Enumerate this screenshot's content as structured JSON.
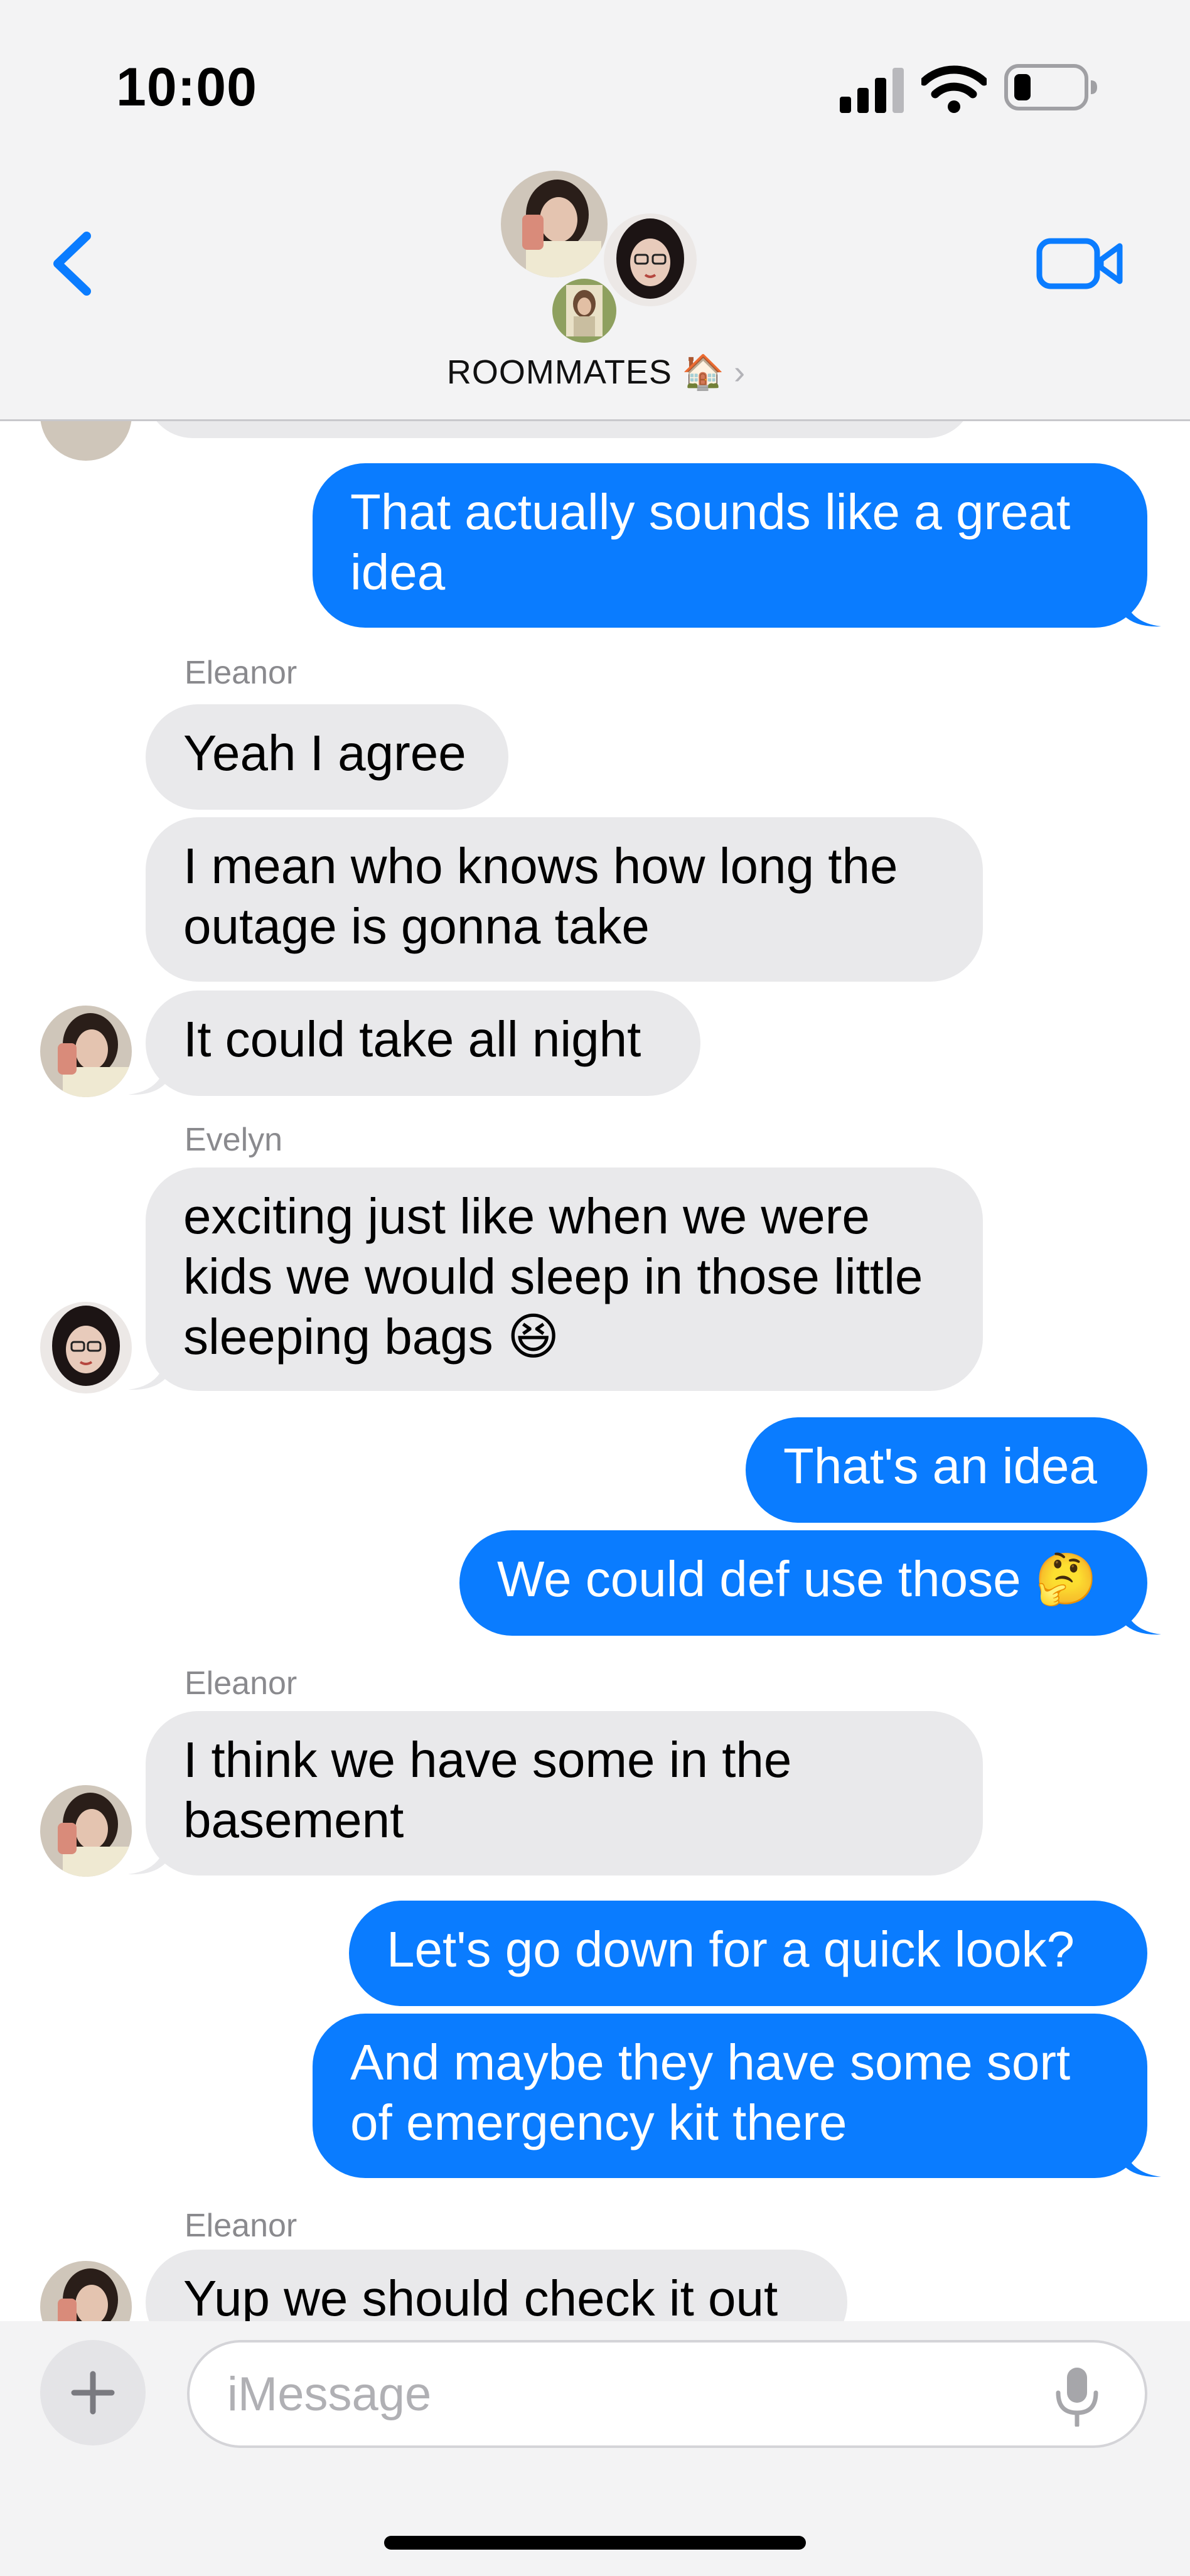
{
  "status_bar": {
    "time": "10:00"
  },
  "header": {
    "group_name": "ROOMMATES",
    "group_emoji": "🏠",
    "chevron": "›"
  },
  "messages": [
    {
      "text": "That actually sounds like a great idea"
    },
    {
      "sender": "Eleanor",
      "text": "Yeah I agree"
    },
    {
      "text": "I mean who knows how long the outage is gonna take"
    },
    {
      "text": "It could take all night"
    },
    {
      "sender": "Evelyn",
      "text": "exciting just like when we were kids we would sleep in those little sleeping bags 😆"
    },
    {
      "text": "That's an idea"
    },
    {
      "text": "We could def use those 🤔"
    },
    {
      "sender": "Eleanor",
      "text": "I think we have some in the basement"
    },
    {
      "text": "Let's go down for a quick look?"
    },
    {
      "text": "And maybe they have some sort of emergency kit there"
    },
    {
      "sender": "Eleanor",
      "text": "Yup we should check it out"
    }
  ],
  "composer": {
    "placeholder": "iMessage"
  },
  "colors": {
    "outgoing": "#0a7cff",
    "incoming": "#e9e9eb",
    "accent": "#0a7cff"
  },
  "icons": [
    "back-chevron-icon",
    "facetime-video-icon",
    "plus-icon",
    "microphone-icon",
    "signal-icon",
    "wifi-icon",
    "battery-icon"
  ]
}
